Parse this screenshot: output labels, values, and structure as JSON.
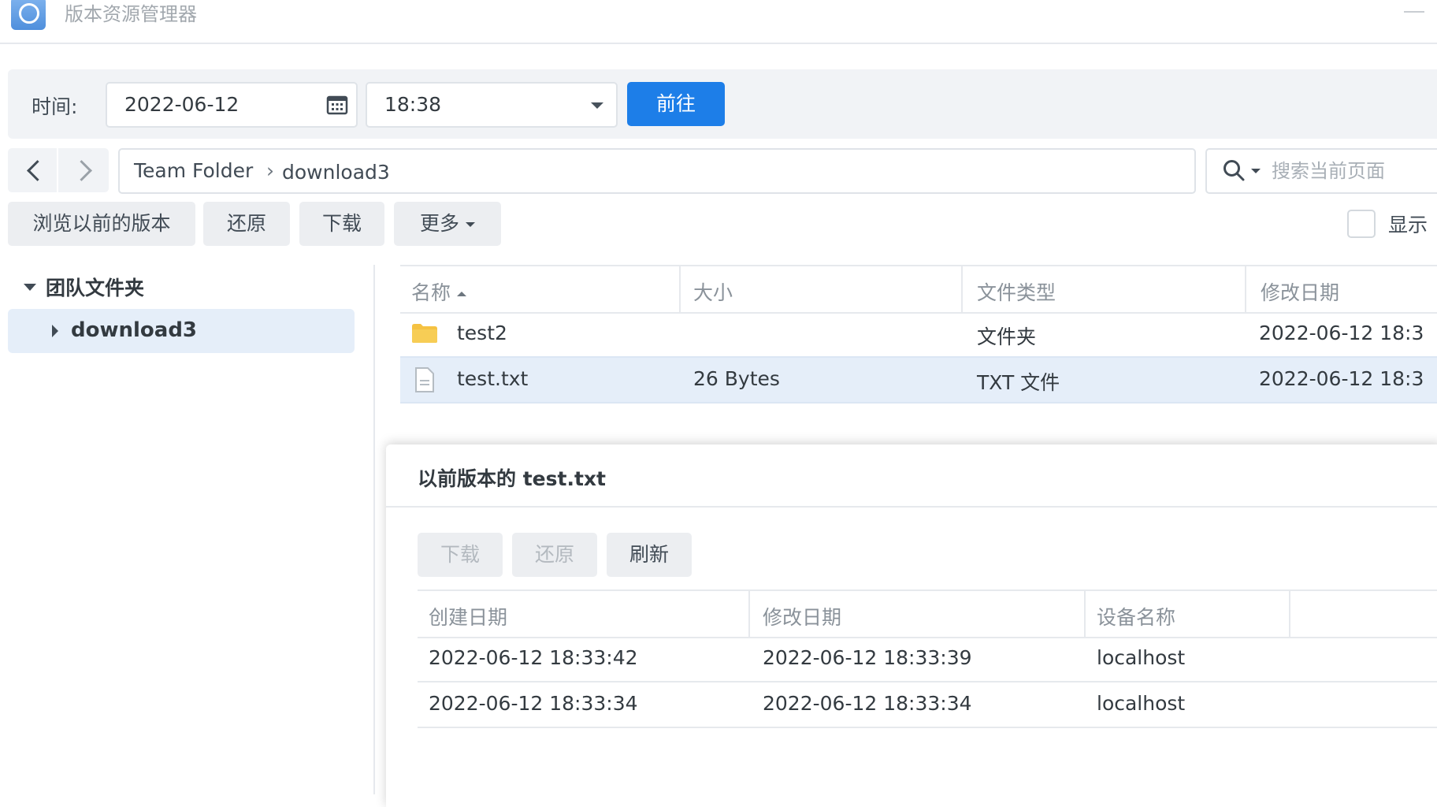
{
  "window": {
    "title": "版本资源管理器"
  },
  "timebar": {
    "label": "时间:",
    "date": "2022-06-12",
    "time": "18:38",
    "go_label": "前往"
  },
  "path": {
    "segments": [
      "Team Folder",
      "download3"
    ],
    "separator": "›"
  },
  "search": {
    "placeholder": "搜索当前页面"
  },
  "actions": {
    "browse": "浏览以前的版本",
    "restore": "还原",
    "download": "下载",
    "more": "更多",
    "show_label": "显示"
  },
  "tree": {
    "root": "团队文件夹",
    "items": [
      {
        "label": "download3"
      }
    ]
  },
  "files": {
    "columns": [
      "名称",
      "大小",
      "文件类型",
      "修改日期"
    ],
    "rows": [
      {
        "name": "test2",
        "size": "",
        "type": "文件夹",
        "modified": "2022-06-12 18:3",
        "icon": "folder-icon"
      },
      {
        "name": "test.txt",
        "size": "26 Bytes",
        "type": "TXT 文件",
        "modified": "2022-06-12 18:3",
        "icon": "text-file-icon"
      }
    ]
  },
  "dialog": {
    "title": "以前版本的 test.txt",
    "buttons": {
      "download": "下载",
      "restore": "还原",
      "refresh": "刷新"
    },
    "columns": [
      "创建日期",
      "修改日期",
      "设备名称"
    ],
    "rows": [
      {
        "created": "2022-06-12 18:33:42",
        "modified": "2022-06-12 18:33:39",
        "device": "localhost"
      },
      {
        "created": "2022-06-12 18:33:34",
        "modified": "2022-06-12 18:33:34",
        "device": "localhost"
      }
    ]
  },
  "colors": {
    "accent": "#1d7ee8",
    "selection": "#e5eef9",
    "folder": "#f5c242"
  }
}
